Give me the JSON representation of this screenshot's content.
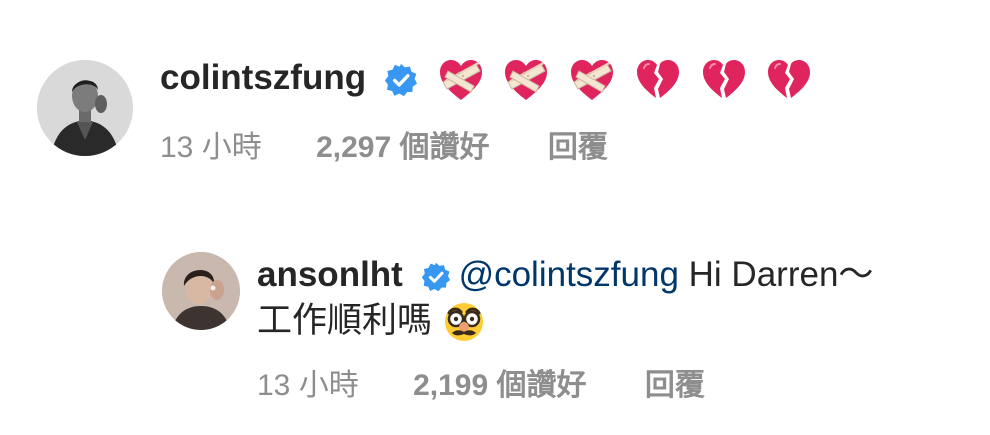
{
  "comments": [
    {
      "username": "colintszfung",
      "verified": true,
      "text_emojis": [
        "heart-with-bandage",
        "heart-with-bandage",
        "heart-with-bandage",
        "broken-heart",
        "broken-heart",
        "broken-heart"
      ],
      "time": "13 小時",
      "likes": "2,297 個讚好",
      "reply_label": "回覆"
    },
    {
      "username": "ansonlht",
      "verified": true,
      "mention": "@colintszfung",
      "text_line1": " Hi Darren～",
      "text_line2": "工作順利嗎",
      "emoji": "disguised-face",
      "time": "13 小時",
      "likes": "2,199 個讚好",
      "reply_label": "回覆"
    }
  ],
  "colors": {
    "verified_blue": "#3897f0",
    "mention": "#00376b",
    "meta_gray": "#8e8e8e",
    "text": "#262626"
  }
}
